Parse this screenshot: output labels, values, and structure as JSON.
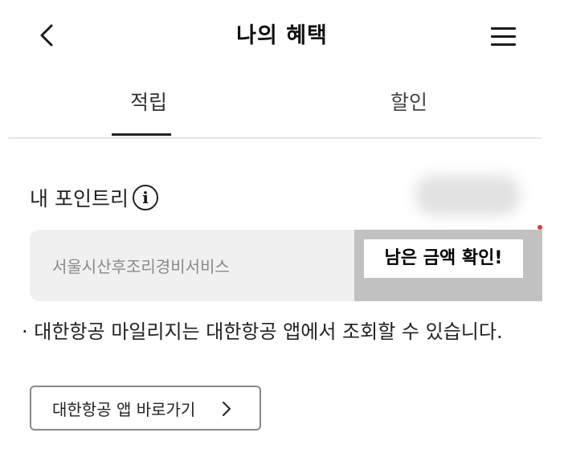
{
  "header": {
    "back_icon": "chevron-left-icon",
    "title": "나의 혜택",
    "menu_icon": "hamburger-menu-icon"
  },
  "tabs": [
    {
      "label": "적립",
      "selected": true
    },
    {
      "label": "할인",
      "selected": false
    }
  ],
  "points": {
    "label": "내 포인트리",
    "info_icon": "info-icon",
    "info_glyph": "i"
  },
  "service": {
    "name": "서울시산후조리경비서비스",
    "callout": "남은 금액 확인!"
  },
  "notice": {
    "text": "· 대한항공 마일리지는 대한항공 앱에서 조회할 수 있습니다."
  },
  "app_button": {
    "label": "대한항공 앱 바로가기",
    "icon": "chevron-right-icon"
  },
  "colors": {
    "overlay_gray": "#c1c1c1",
    "box_background": "#f0f0f0",
    "indicator_red": "#e53935"
  }
}
